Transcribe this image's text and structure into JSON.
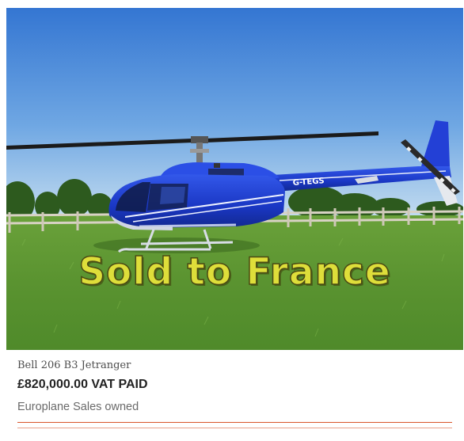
{
  "listing": {
    "banner_text": "Sold to France",
    "registration": "G-TEGS",
    "model": "Bell 206 B3 Jetranger",
    "price": "£820,000.00 VAT PAID",
    "owner": "Europlane Sales owned"
  },
  "colors": {
    "sky_top": "#3d7ed6",
    "sky_bottom": "#b8d6ee",
    "grass": "#5f9a34",
    "helicopter_body": "#1f3fd0",
    "banner_fill": "#dede3a",
    "divider": "#d9552b"
  }
}
